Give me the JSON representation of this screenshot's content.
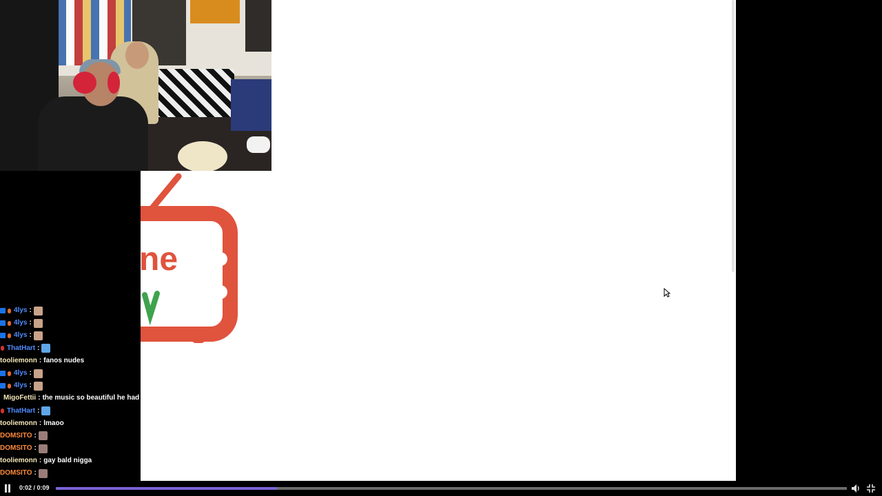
{
  "chat": {
    "messages": [
      {
        "user": "4lys",
        "color": "#4f8cff",
        "badges": [
          "prime-icon",
          "orange-dot"
        ],
        "text": "",
        "emote": "hand-emote"
      },
      {
        "user": "4lys",
        "color": "#4f8cff",
        "badges": [
          "prime-icon",
          "orange-dot"
        ],
        "text": "",
        "emote": "hand-emote"
      },
      {
        "user": "4lys",
        "color": "#4f8cff",
        "badges": [
          "prime-icon",
          "orange-dot"
        ],
        "text": "",
        "emote": "hand-emote"
      },
      {
        "user": "ThatHart",
        "color": "#4f8cff",
        "badges": [
          "red-dot"
        ],
        "text": "",
        "emote": "blue-emote"
      },
      {
        "user": "tooliemonn",
        "color": "#f3e6b8",
        "badges": [],
        "text": "fanos nudes",
        "emote": ""
      },
      {
        "user": "4lys",
        "color": "#4f8cff",
        "badges": [
          "prime-icon",
          "orange-dot"
        ],
        "text": "",
        "emote": "hand-emote"
      },
      {
        "user": "4lys",
        "color": "#4f8cff",
        "badges": [
          "prime-icon",
          "orange-dot"
        ],
        "text": "",
        "emote": "hand-emote"
      },
      {
        "user": "MigoFettii",
        "color": "#f3e6b8",
        "badges": [
          "blue-dot"
        ],
        "text": "the music so beautiful he had to jus let it out one time",
        "emote": ""
      },
      {
        "user": "ThatHart",
        "color": "#4f8cff",
        "badges": [
          "red-dot"
        ],
        "text": "",
        "emote": "blue-emote"
      },
      {
        "user": "tooliemonn",
        "color": "#f3e6b8",
        "badges": [],
        "text": "lmaoo",
        "emote": ""
      },
      {
        "user": "DOMSITO",
        "color": "#ff8a3c",
        "badges": [],
        "text": "",
        "emote": "cat-emote"
      },
      {
        "user": "DOMSITO",
        "color": "#ff8a3c",
        "badges": [],
        "text": "",
        "emote": "cat-emote"
      },
      {
        "user": "tooliemonn",
        "color": "#f3e6b8",
        "badges": [],
        "text": "gay bald nigga",
        "emote": ""
      },
      {
        "user": "DOMSITO",
        "color": "#ff8a3c",
        "badges": [],
        "text": "",
        "emote": "cat-emote"
      }
    ]
  },
  "player": {
    "time": "0:02 / 0:09",
    "progress_fraction": 0.28
  },
  "colors": {
    "progress_fill": "#7b62d8",
    "logo_red": "#e0533d",
    "logo_green": "#3fa34d"
  }
}
